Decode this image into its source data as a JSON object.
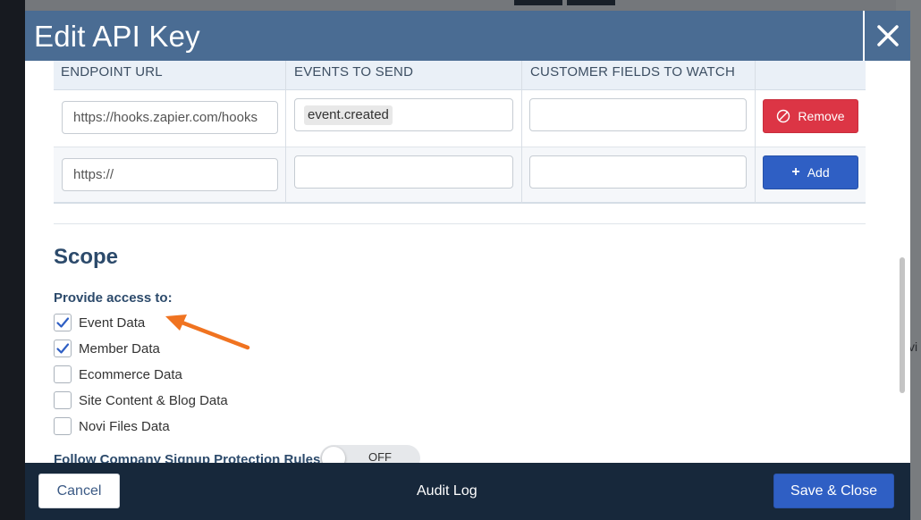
{
  "background": {
    "right_text": "vi"
  },
  "modal": {
    "title": "Edit API Key"
  },
  "webhooks": {
    "columns": [
      "ENDPOINT URL",
      "EVENTS TO SEND",
      "CUSTOMER FIELDS TO WATCH"
    ],
    "rows": [
      {
        "endpoint_url": "https://hooks.zapier.com/hooks",
        "events": [
          "event.created"
        ],
        "customer_fields": "",
        "action_label": "Remove"
      }
    ],
    "new_row": {
      "endpoint_url": "https://",
      "events": "",
      "customer_fields": "",
      "action_label": "Add"
    }
  },
  "scope": {
    "title": "Scope",
    "access_label": "Provide access to:",
    "options": [
      {
        "label": "Event Data",
        "checked": true
      },
      {
        "label": "Member Data",
        "checked": true
      },
      {
        "label": "Ecommerce Data",
        "checked": false
      },
      {
        "label": "Site Content & Blog Data",
        "checked": false
      },
      {
        "label": "Novi Files Data",
        "checked": false
      }
    ],
    "signup_protection": {
      "label": "Follow Company Signup Protection Rules",
      "toggle_text": "OFF",
      "enabled": false
    }
  },
  "footer": {
    "cancel_label": "Cancel",
    "audit_label": "Audit Log",
    "save_label": "Save & Close"
  },
  "colors": {
    "header": "#4a6c93",
    "footer": "#17283b",
    "primary": "#2f5fc4",
    "danger": "#dc3545",
    "annotation_arrow": "#f07320"
  }
}
